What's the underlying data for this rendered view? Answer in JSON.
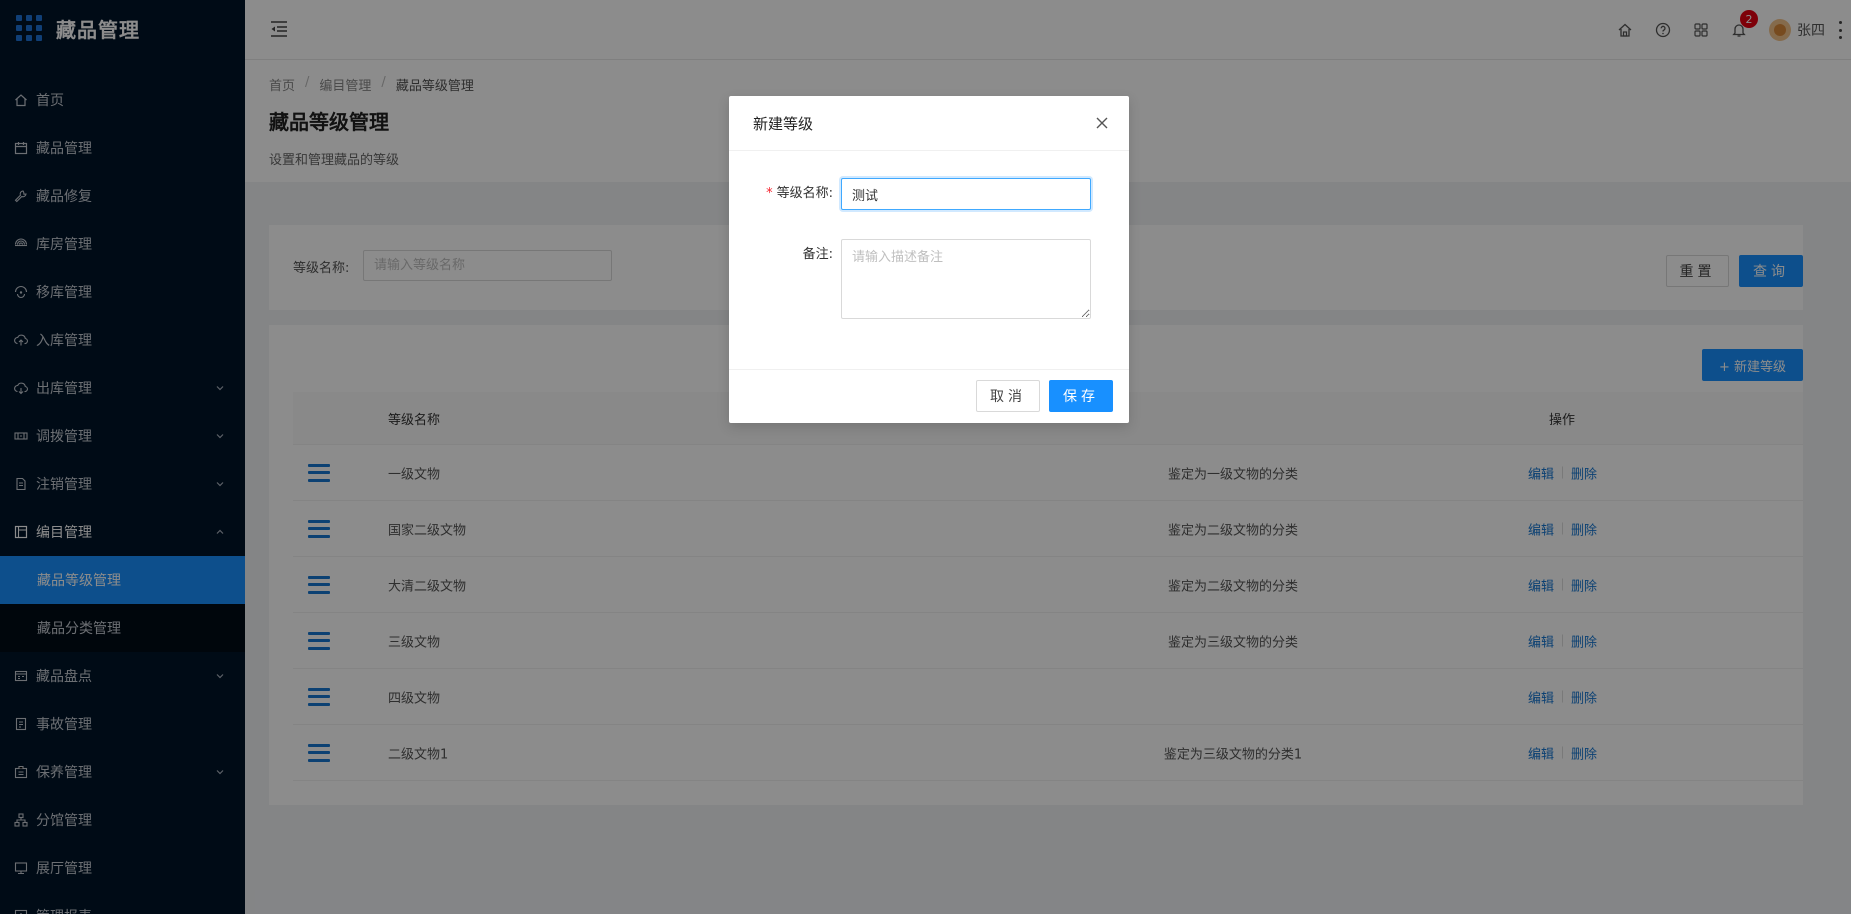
{
  "app": {
    "title": "藏品管理"
  },
  "sidebar": {
    "items": [
      {
        "label": "首页",
        "icon": "home-icon",
        "has_arrow": false
      },
      {
        "label": "藏品管理",
        "icon": "calendar-icon",
        "has_arrow": false
      },
      {
        "label": "藏品修复",
        "icon": "wrench-icon",
        "has_arrow": false
      },
      {
        "label": "库房管理",
        "icon": "warehouse-icon",
        "has_arrow": false
      },
      {
        "label": "移库管理",
        "icon": "transfer-icon",
        "has_arrow": false
      },
      {
        "label": "入库管理",
        "icon": "upload-cloud-icon",
        "has_arrow": false
      },
      {
        "label": "出库管理",
        "icon": "download-cloud-icon",
        "has_arrow": true
      },
      {
        "label": "调拨管理",
        "icon": "allocate-icon",
        "has_arrow": true
      },
      {
        "label": "注销管理",
        "icon": "document-icon",
        "has_arrow": true
      },
      {
        "label": "编目管理",
        "icon": "catalog-icon",
        "has_arrow": true,
        "open": true
      }
    ],
    "sub_items": [
      {
        "label": "藏品等级管理",
        "active": true
      },
      {
        "label": "藏品分类管理",
        "active": false
      }
    ],
    "items_after": [
      {
        "label": "藏品盘点",
        "icon": "inventory-icon",
        "has_arrow": true
      },
      {
        "label": "事故管理",
        "icon": "accident-icon",
        "has_arrow": false
      },
      {
        "label": "保养管理",
        "icon": "maintenance-icon",
        "has_arrow": true
      },
      {
        "label": "分馆管理",
        "icon": "branch-icon",
        "has_arrow": false
      },
      {
        "label": "展厅管理",
        "icon": "hall-icon",
        "has_arrow": false
      },
      {
        "label": "管理报表",
        "icon": "report-icon",
        "has_arrow": true
      }
    ]
  },
  "header": {
    "notification_count": "2",
    "username": "张四"
  },
  "breadcrumb": [
    "首页",
    "编目管理",
    "藏品等级管理"
  ],
  "page": {
    "title": "藏品等级管理",
    "description": "设置和管理藏品的等级"
  },
  "filter": {
    "label": "等级名称:",
    "placeholder": "请输入等级名称",
    "reset_label": "重置",
    "query_label": "查询"
  },
  "table": {
    "new_button": "+ 新建等级",
    "headers": {
      "name": "等级名称",
      "desc": "",
      "op": "操作"
    },
    "rows": [
      {
        "name": "一级文物",
        "desc": "鉴定为一级文物的分类"
      },
      {
        "name": "国家二级文物",
        "desc": "鉴定为二级文物的分类"
      },
      {
        "name": "大清二级文物",
        "desc": "鉴定为二级文物的分类"
      },
      {
        "name": "三级文物",
        "desc": "鉴定为三级文物的分类"
      },
      {
        "name": "四级文物",
        "desc": ""
      },
      {
        "name": "二级文物1",
        "desc": "鉴定为三级文物的分类1"
      }
    ],
    "edit_label": "编辑",
    "delete_label": "删除"
  },
  "modal": {
    "title": "新建等级",
    "name_label": "等级名称:",
    "name_value": "测试",
    "remark_label": "备注:",
    "remark_placeholder": "请输入描述备注",
    "cancel_label": "取消",
    "save_label": "保存"
  },
  "colors": {
    "sidebar_bg": "#001529",
    "primary": "#1890ff",
    "badge": "#e60012",
    "required": "#f5222d"
  }
}
